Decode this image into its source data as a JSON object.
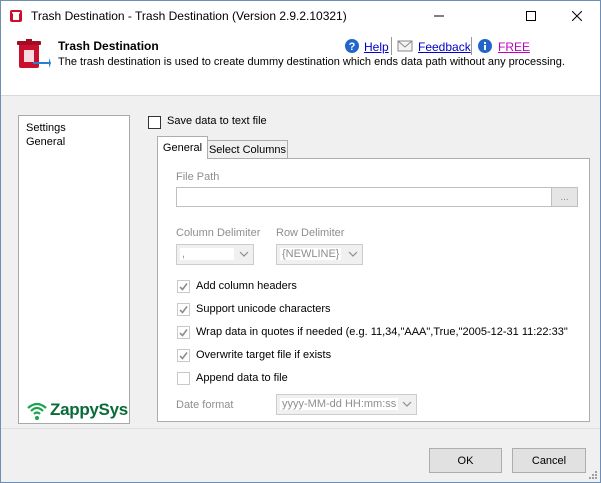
{
  "window": {
    "title": "Trash Destination - Trash Destination (Version 2.9.2.10321)",
    "controls": {
      "minimize": "minimize-icon",
      "maximize": "maximize-icon",
      "close": "close-icon"
    }
  },
  "header": {
    "title": "Trash Destination",
    "description": "The trash destination is used to create dummy destination which ends data path without any processing.",
    "links": {
      "help": "Help",
      "feedback": "Feedback",
      "free": "FREE"
    }
  },
  "nav": {
    "items": [
      "Settings",
      "General"
    ],
    "logo_text": "ZappySys"
  },
  "settings": {
    "save_to_file_label": "Save data to text file",
    "save_to_file_checked": false,
    "tabs": [
      "General",
      "Select Columns"
    ],
    "active_tab": 0,
    "file_path": {
      "label": "File Path",
      "value": "",
      "browse_label": "..."
    },
    "column_delimiter": {
      "label": "Column Delimiter",
      "value": ","
    },
    "row_delimiter": {
      "label": "Row Delimiter",
      "value": "{NEWLINE}"
    },
    "options": [
      {
        "label": "Add column headers",
        "checked": true
      },
      {
        "label": "Support unicode characters",
        "checked": true
      },
      {
        "label": "Wrap data in quotes if needed (e.g. 11,34,\"AAA\",True,\"2005-12-31 11:22:33\"",
        "checked": true
      },
      {
        "label": "Overwrite target file if exists",
        "checked": true
      },
      {
        "label": "Append data to file",
        "checked": false
      }
    ],
    "date_format": {
      "label": "Date format",
      "value": "yyyy-MM-dd HH:mm:ss"
    }
  },
  "footer": {
    "ok_label": "OK",
    "cancel_label": "Cancel"
  },
  "colors": {
    "link": "#0000cc",
    "free_link": "#c000c0",
    "logo_green": "#0a6a3a",
    "disabled_text": "#8e8e8e"
  }
}
